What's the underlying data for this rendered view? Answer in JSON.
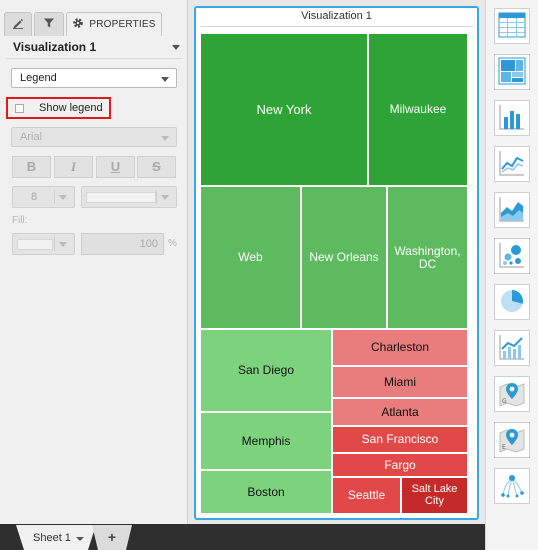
{
  "panel": {
    "tabs": [
      {
        "label": "",
        "icon": "pencil-icon"
      },
      {
        "label": "",
        "icon": "filter-icon"
      },
      {
        "label": "PROPERTIES",
        "icon": "gear-icon"
      }
    ],
    "title": "Visualization 1",
    "section_select": "Legend",
    "show_legend": {
      "label": "Show legend",
      "checked": false
    },
    "font_select": "Arial",
    "format_buttons": [
      "B",
      "I",
      "U",
      "S"
    ],
    "font_size": "8",
    "fill_label": "Fill:",
    "opacity": "100",
    "percent_symbol": "%"
  },
  "sheet_bar": {
    "tab_label": "Sheet 1",
    "add_label": "+"
  },
  "visualization": {
    "title": "Visualization 1",
    "colors": {
      "dark_green": "#2ea336",
      "mid_green": "#5dba5f",
      "light_green": "#7dd27d",
      "salmon": "#e97c7c",
      "red": "#e14848",
      "dark_red": "#c52a2a",
      "frame_highlight": "#3aa8e0",
      "legend_highlight": "#e0191f"
    }
  },
  "chart_data": {
    "type": "treemap",
    "title": "Visualization 1",
    "cells": [
      {
        "label": "New York",
        "color": "#2ea336"
      },
      {
        "label": "Milwaukee",
        "color": "#2ea336"
      },
      {
        "label": "Web",
        "color": "#5dba5f"
      },
      {
        "label": "New Orleans",
        "color": "#5dba5f"
      },
      {
        "label": "Washington, DC",
        "color": "#5dba5f"
      },
      {
        "label": "San Diego",
        "color": "#7dd27d"
      },
      {
        "label": "Memphis",
        "color": "#7dd27d"
      },
      {
        "label": "Boston",
        "color": "#7dd27d"
      },
      {
        "label": "Charleston",
        "color": "#e97c7c"
      },
      {
        "label": "Miami",
        "color": "#e97c7c"
      },
      {
        "label": "Atlanta",
        "color": "#e97c7c"
      },
      {
        "label": "San Francisco",
        "color": "#e14848"
      },
      {
        "label": "Fargo",
        "color": "#e14848"
      },
      {
        "label": "Seattle",
        "color": "#e14848"
      },
      {
        "label": "Salt Lake City",
        "color": "#c52a2a"
      }
    ]
  },
  "toolbar": {
    "items": [
      "table-icon",
      "treemap-icon",
      "bar-chart-icon",
      "line-chart-icon",
      "area-chart-icon",
      "bubble-chart-icon",
      "pie-chart-icon",
      "combo-chart-icon",
      "map-marker-icon",
      "geo-map-icon",
      "network-icon"
    ]
  }
}
